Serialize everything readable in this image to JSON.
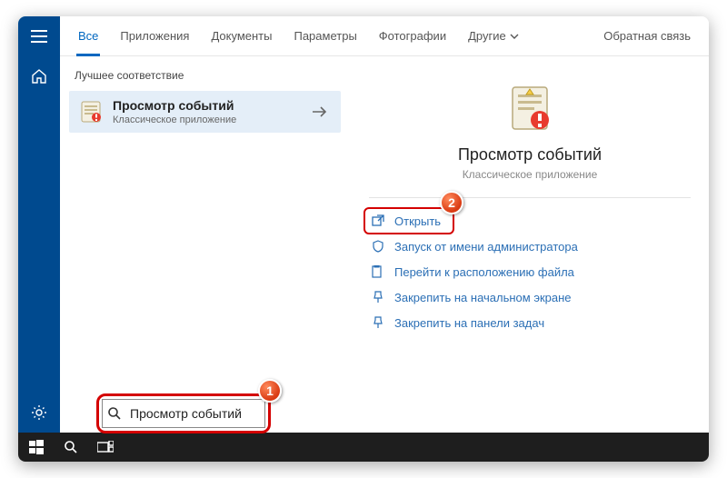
{
  "tabs": {
    "items": [
      "Все",
      "Приложения",
      "Документы",
      "Параметры",
      "Фотографии"
    ],
    "more": "Другие",
    "feedback": "Обратная связь",
    "activeIndex": 0
  },
  "left": {
    "bestMatchHeader": "Лучшее соответствие",
    "result": {
      "title": "Просмотр событий",
      "subtitle": "Классическое приложение"
    }
  },
  "preview": {
    "title": "Просмотр событий",
    "subtitle": "Классическое приложение"
  },
  "actions": {
    "open": "Открыть",
    "runAsAdmin": "Запуск от имени администратора",
    "openLocation": "Перейти к расположению файла",
    "pinStart": "Закрепить на начальном экране",
    "pinTaskbar": "Закрепить на панели задач"
  },
  "search": {
    "value": "Просмотр событий"
  },
  "annotations": {
    "one": "1",
    "two": "2"
  }
}
